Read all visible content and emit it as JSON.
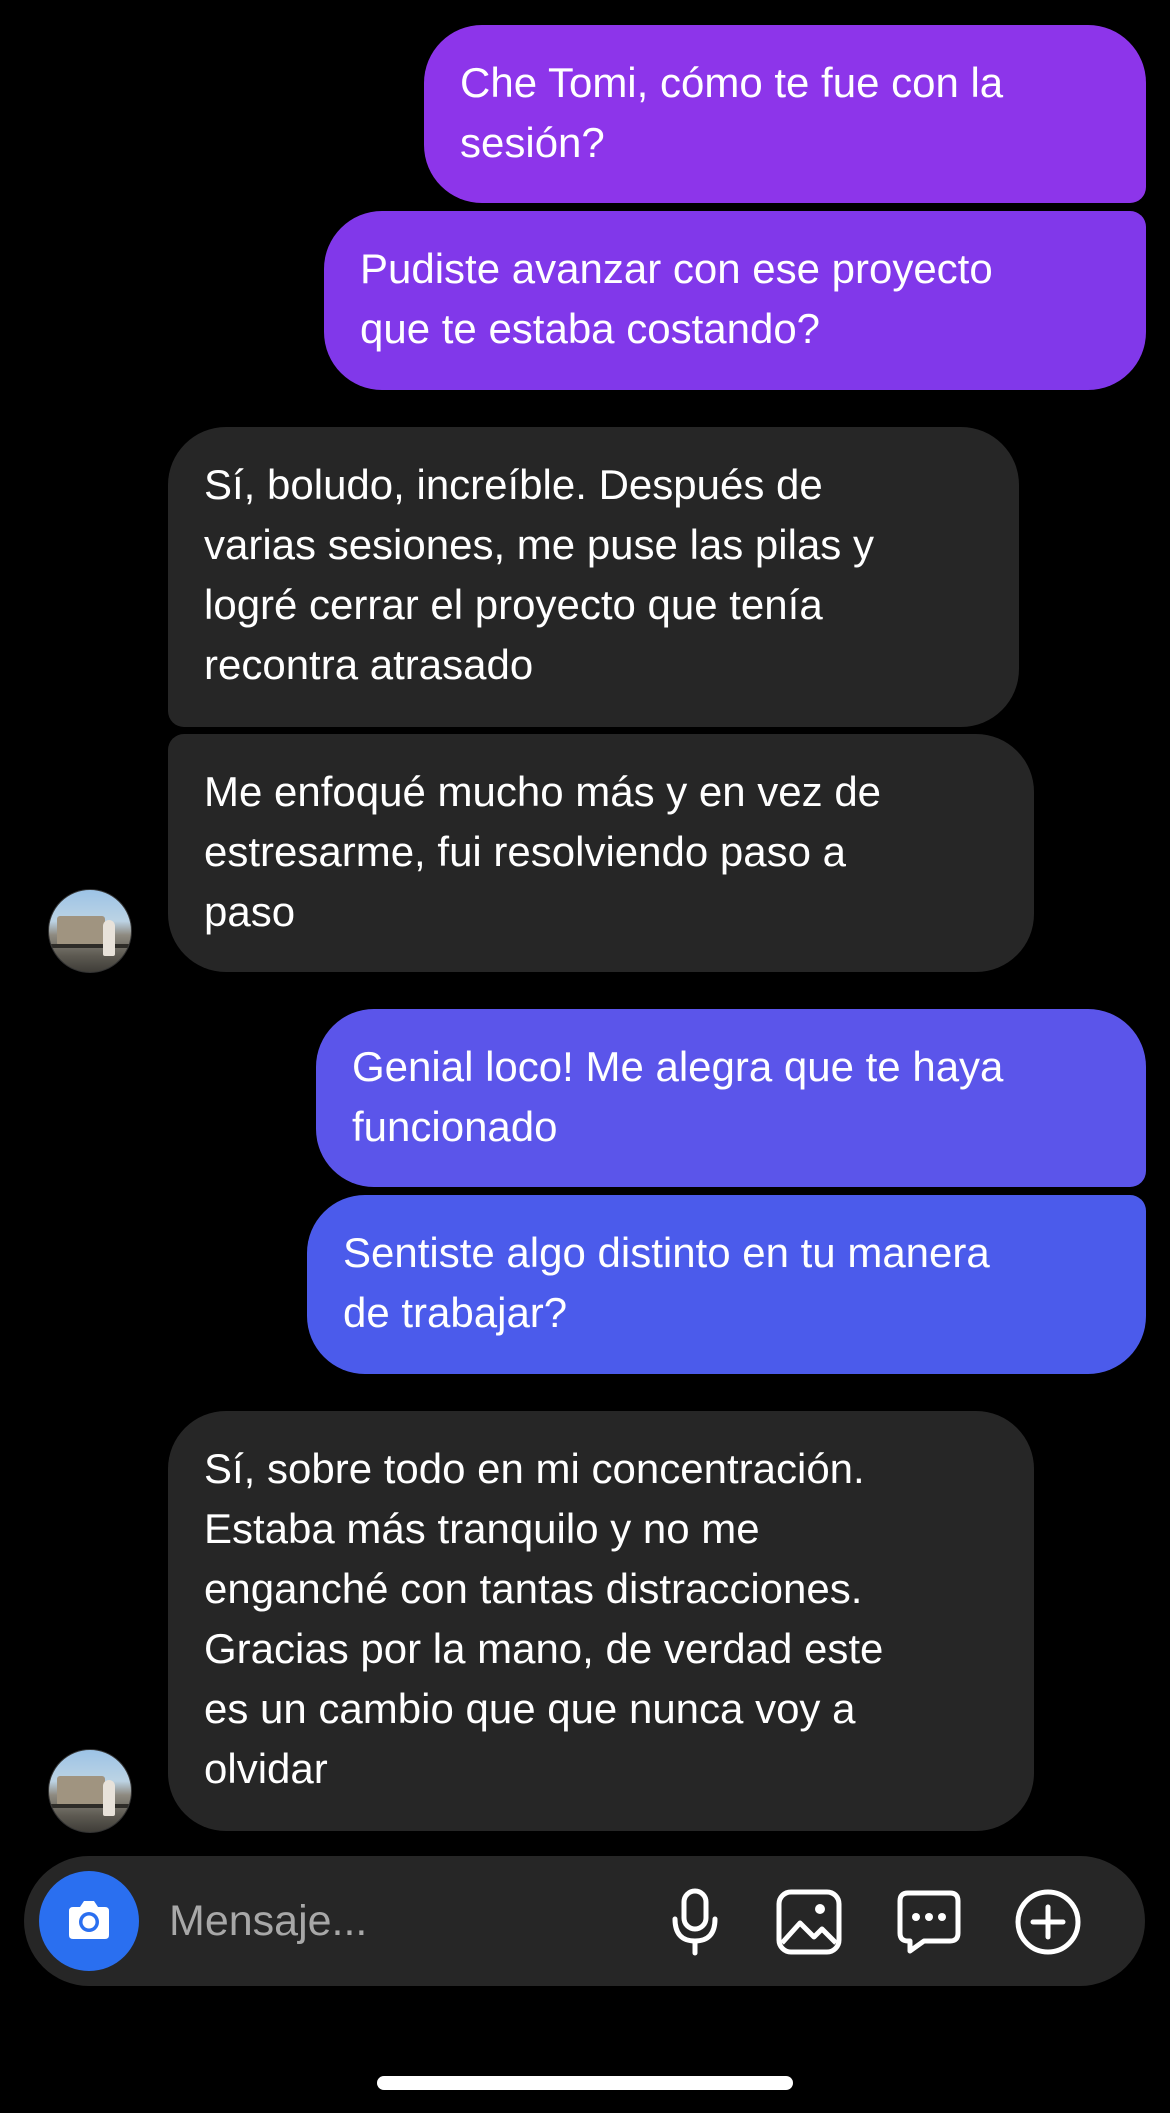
{
  "messages": [
    {
      "direction": "outgoing",
      "text": "Che Tomi, cómo te fue con la\nsesión?",
      "color": "#8d35ea"
    },
    {
      "direction": "outgoing",
      "text": "Pudiste avanzar con ese proyecto\nque te estaba costando?",
      "color": "#8138ea"
    },
    {
      "direction": "incoming",
      "text": "Sí, boludo, increíble. Después de\nvarias sesiones, me puse las pilas y\nlogré cerrar el proyecto que tenía\nrecontra atrasado",
      "color": "#262626"
    },
    {
      "direction": "incoming",
      "text": "Me enfoqué mucho más y en vez de\nestresarme, fui resolviendo paso a\npaso",
      "color": "#262626"
    },
    {
      "direction": "outgoing",
      "text": "Genial loco! Me alegra que te haya\nfuncionado",
      "color": "#5b55ea"
    },
    {
      "direction": "outgoing",
      "text": "Sentiste algo distinto en tu manera\nde trabajar?",
      "color": "#4b5beb"
    },
    {
      "direction": "incoming",
      "text": "Sí, sobre todo en mi concentración.\nEstaba más tranquilo y no me\nenganché con tantas distracciones.\nGracias por la mano, de verdad este\nes un cambio que que nunca voy a\nolvidar",
      "color": "#262626"
    }
  ],
  "composer": {
    "placeholder": "Mensaje...",
    "icons": [
      "camera-icon",
      "microphone-icon",
      "gallery-icon",
      "sticker-chat-icon",
      "plus-circle-icon"
    ],
    "camera_button_color": "#2a6ff0"
  },
  "contact": {
    "avatar_icon": "contact-avatar"
  }
}
